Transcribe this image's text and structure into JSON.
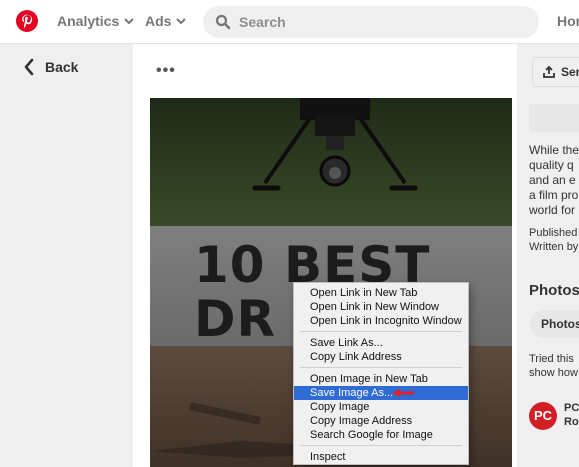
{
  "header": {
    "analytics_label": "Analytics",
    "ads_label": "Ads",
    "search_placeholder": "Search",
    "home_label": "Hon",
    "brand_color": "#e60023"
  },
  "left": {
    "back_label": "Back"
  },
  "pin": {
    "more_label": "•••",
    "headline_line1": "10 BEST",
    "headline_line2": "DR"
  },
  "context_menu": {
    "items": [
      "Open Link in New Tab",
      "Open Link in New Window",
      "Open Link in Incognito Window",
      "Save Link As...",
      "Copy Link Address",
      "Open Image in New Tab",
      "Save Image As...",
      "Copy Image",
      "Copy Image Address",
      "Search Google for Image",
      "Inspect"
    ],
    "selected": "Save Image As...",
    "highlight_color": "#2f6bd5"
  },
  "right": {
    "send_label": "Ser",
    "description": [
      "While the",
      "quality q",
      "and an e",
      "a film pro",
      "world for"
    ],
    "published": "Published",
    "written_by": "Written by",
    "photos_heading": "Photos",
    "photos_pill": "Photos",
    "tried_lines": [
      "Tried this",
      "show how"
    ],
    "publisher_logo": "PC",
    "publisher_lines": [
      "PC",
      "Ro"
    ]
  }
}
